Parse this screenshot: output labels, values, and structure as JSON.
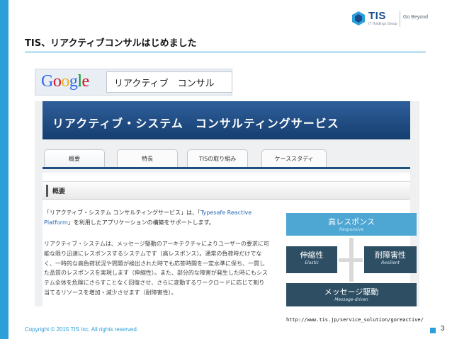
{
  "colors": {
    "accent": "#2d9fd8",
    "brand_navy": "#1a4b8c",
    "site_header": "#1f4e83"
  },
  "logo": {
    "name": "TIS",
    "sub": "IT Holdings Group",
    "tagline": "Go Beyond"
  },
  "slide": {
    "title": "TIS、リアクティブコンサルはじめました"
  },
  "google": {
    "letters": [
      "G",
      "o",
      "o",
      "g",
      "l",
      "e"
    ],
    "letter_colors": [
      "#3369e8",
      "#d50f25",
      "#eeb211",
      "#3369e8",
      "#009925",
      "#d50f25"
    ],
    "query": "リアクティブ　コンサル"
  },
  "website": {
    "title": "リアクティブ・システム　コンサルティングサービス",
    "tabs": [
      "概要",
      "特長",
      "TISの取り組み",
      "ケーススタディ"
    ],
    "section_heading": "概要",
    "intro_1": "「リアクティブ・システム コンサルティングサービス」は、「",
    "intro_link": "Typesafe Reactive Platform",
    "intro_2": "」を利用したアプリケーションの構築をサポートします。",
    "body": "リアクティブ・システムは、メッセージ駆動のアーキテクチャによりユーザーの要求に可能な限り迅速にレスポンスするシステムです（高レスポンス）。通常の負荷時だけでなく、一時的な高負荷状況や問題が検出された時でも応答時間を一定水準に保ち、一貫した品質のレスポンスを実現します（伸縮性）。また、部分的な障害が発生した時にもシステム全体を危険にさらすことなく回復させ、さらに変動するワークロードに応じて割り当てるリソースを増加・減少させます（耐障害性）。",
    "diagram": {
      "top": {
        "main": "高レスポンス",
        "en": "Responsive"
      },
      "left": {
        "main": "伸縮性",
        "en": "Elastic"
      },
      "right": {
        "main": "耐障害性",
        "en": "Resilient"
      },
      "bottom": {
        "main": "メッセージ駆動",
        "en": "Message-driven"
      }
    }
  },
  "footer": {
    "source_url": "http://www.tis.jp/service_solution/goreactive/",
    "copyright": "Copyright © 2015 TIS Inc. All rights reserved.",
    "page_number": "3"
  }
}
